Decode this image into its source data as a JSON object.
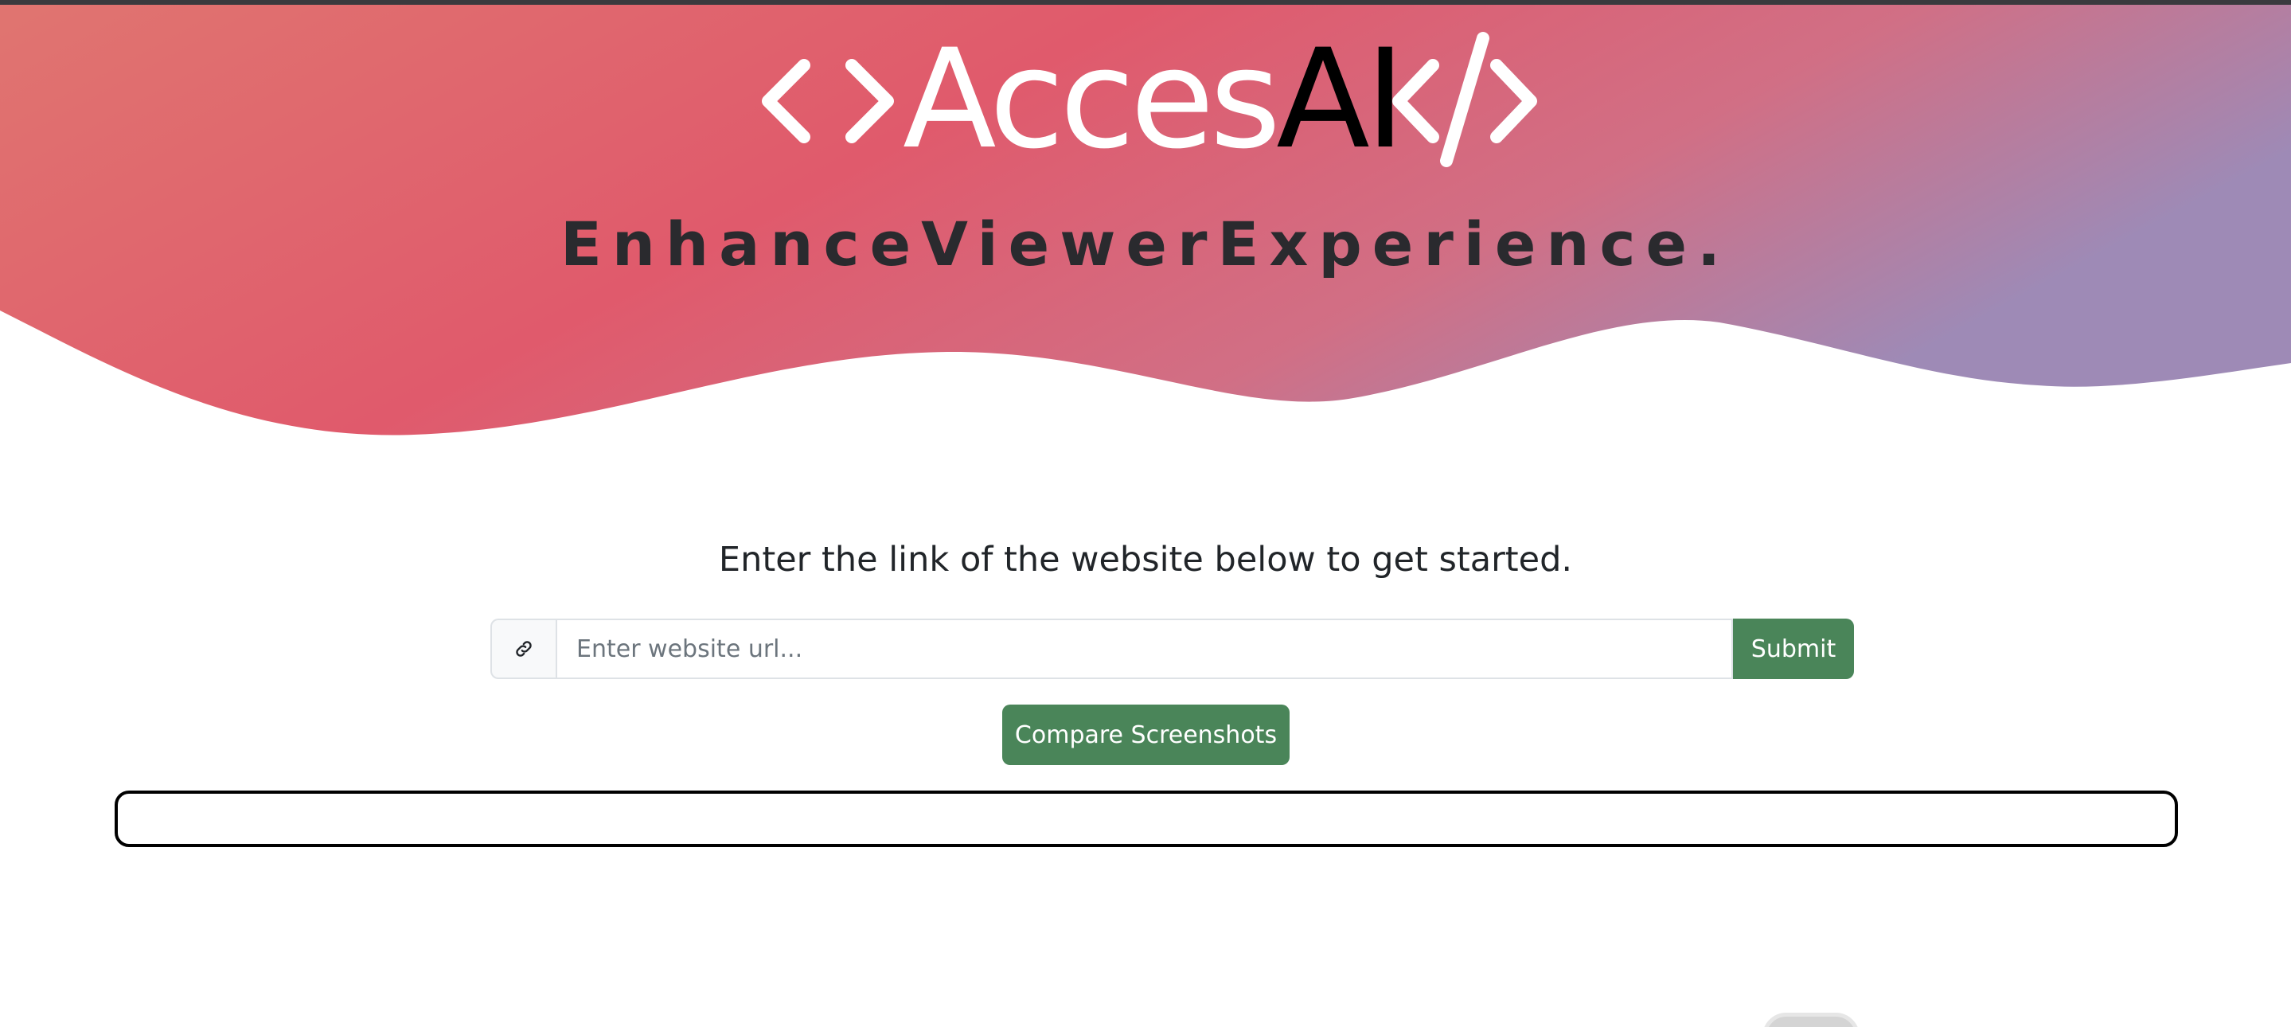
{
  "brand": {
    "name_main": "Acces",
    "name_accent": "AI",
    "left_icon": "code-brackets-icon",
    "right_icon": "code-slash-icon",
    "tagline": "EnhanceViewerExperience."
  },
  "colors": {
    "hero_gradient": [
      "#e07570",
      "#e05a6c",
      "#d76e80",
      "#9e8ab6"
    ],
    "button": "#4a8559",
    "text_dark": "#212529"
  },
  "main": {
    "prompt": "Enter the link of the website below to get started.",
    "url_input": {
      "placeholder": "Enter website url...",
      "value": "",
      "icon": "link-icon"
    },
    "submit_label": "Submit",
    "compare_label": "Compare Screenshots"
  }
}
